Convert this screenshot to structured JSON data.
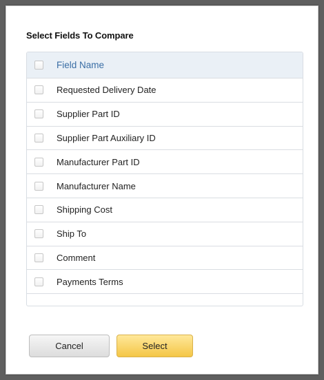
{
  "dialog": {
    "title": "Select Fields To Compare"
  },
  "table": {
    "header_label": "Field Name",
    "rows": [
      "Requested Delivery Date",
      "Supplier Part ID",
      "Supplier Part Auxiliary ID",
      "Manufacturer Part ID",
      "Manufacturer Name",
      "Shipping Cost",
      "Ship To",
      "Comment",
      "Payments Terms"
    ]
  },
  "buttons": {
    "cancel_label": "Cancel",
    "select_label": "Select"
  },
  "colors": {
    "header_bg": "#eaf0f6",
    "header_text": "#3a6ea5",
    "select_button": "#f4c646",
    "cancel_button": "#dcdcdc"
  }
}
